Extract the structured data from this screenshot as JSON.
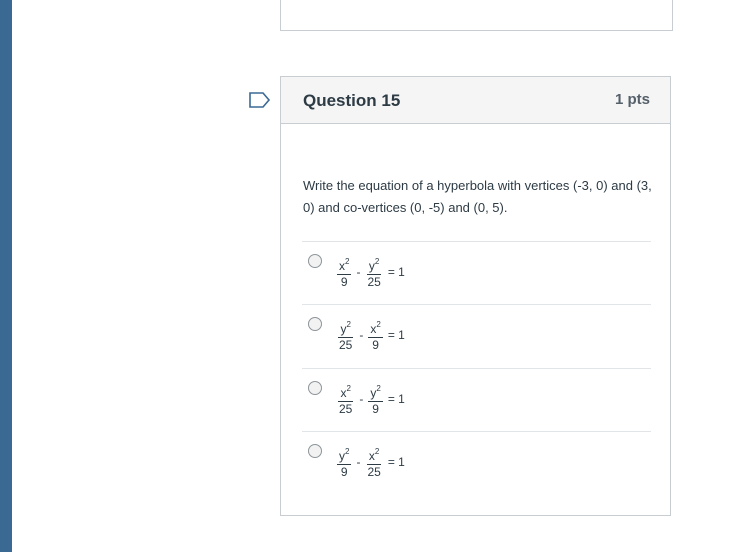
{
  "question": {
    "title": "Question 15",
    "points": "1 pts",
    "text": "Write the equation of a hyperbola with vertices (-3, 0) and (3, 0) and co-vertices (0, -5) and (0, 5)."
  },
  "answers": [
    {
      "num1": "x",
      "den1": "9",
      "num2": "y",
      "den2": "25",
      "op": "-",
      "rhs": "= 1",
      "exp": "2"
    },
    {
      "num1": "y",
      "den1": "25",
      "num2": "x",
      "den2": "9",
      "op": "-",
      "rhs": "= 1",
      "exp": "2"
    },
    {
      "num1": "x",
      "den1": "25",
      "num2": "y",
      "den2": "9",
      "op": "-",
      "rhs": "= 1",
      "exp": "2"
    },
    {
      "num1": "y",
      "den1": "9",
      "num2": "x",
      "den2": "25",
      "op": "-",
      "rhs": "= 1",
      "exp": "2"
    }
  ],
  "icons": {
    "flag": "flag-outline-icon",
    "radio": "radio-button-icon"
  },
  "colors": {
    "left_bar": "#3a6a94",
    "header_bg": "#f5f5f5",
    "border": "#c7cdd1"
  }
}
